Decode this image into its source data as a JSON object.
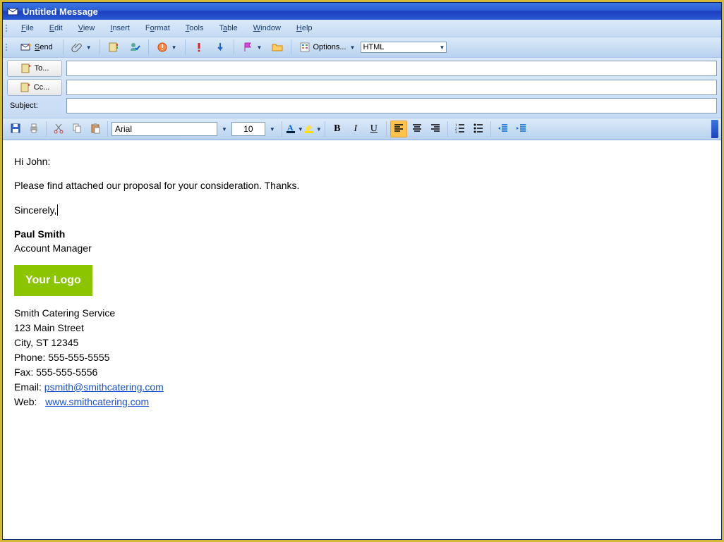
{
  "window": {
    "title": "Untitled Message"
  },
  "menu": {
    "file": "File",
    "edit": "Edit",
    "view": "View",
    "insert": "Insert",
    "format": "Format",
    "tools": "Tools",
    "table": "Table",
    "window": "Window",
    "help": "Help"
  },
  "toolbar": {
    "send": "Send",
    "options": "Options...",
    "format_select": "HTML"
  },
  "recipients": {
    "to_label": "To...",
    "cc_label": "Cc...",
    "subject_label": "Subject:",
    "to_value": "",
    "cc_value": "",
    "subject_value": ""
  },
  "format": {
    "font": "Arial",
    "size": "10",
    "bold": "B",
    "italic": "I",
    "underline": "U"
  },
  "body": {
    "greeting": "Hi John:",
    "line1": "Please find attached our proposal for your consideration.  Thanks.",
    "closing": "Sincerely,",
    "sig_name": "Paul Smith",
    "sig_title": "Account Manager",
    "logo_text": "Your Logo",
    "company": "Smith Catering Service",
    "addr1": "123 Main Street",
    "addr2": "City, ST 12345",
    "phone_label": "Phone: ",
    "phone": "555-555-5555",
    "fax_label": "Fax: ",
    "fax": "555-555-5556",
    "email_label": "Email: ",
    "email": "psmith@smithcatering.com",
    "web_label": "Web:   ",
    "web": "www.smithcatering.com"
  }
}
